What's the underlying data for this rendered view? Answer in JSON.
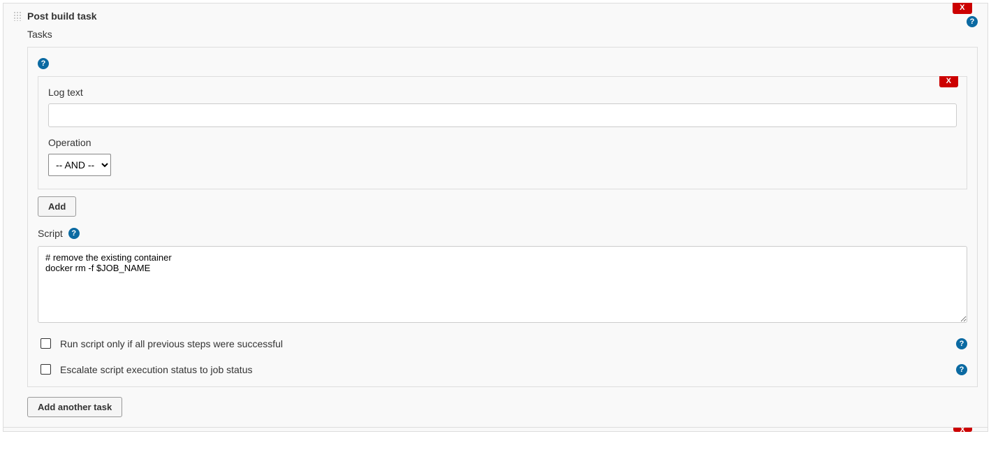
{
  "panel": {
    "title": "Post build task",
    "close_label": "X"
  },
  "tasks": {
    "label": "Tasks"
  },
  "log": {
    "label": "Log text",
    "value": "",
    "close_label": "X"
  },
  "operation": {
    "label": "Operation",
    "selected": "-- AND --"
  },
  "buttons": {
    "add": "Add",
    "add_another": "Add another task"
  },
  "script": {
    "label": "Script",
    "value": "# remove the existing container\ndocker rm -f $JOB_NAME"
  },
  "checkboxes": {
    "run_if_success": "Run script only if all previous steps were successful",
    "escalate": "Escalate script execution status to job status"
  },
  "help_glyph": "?"
}
